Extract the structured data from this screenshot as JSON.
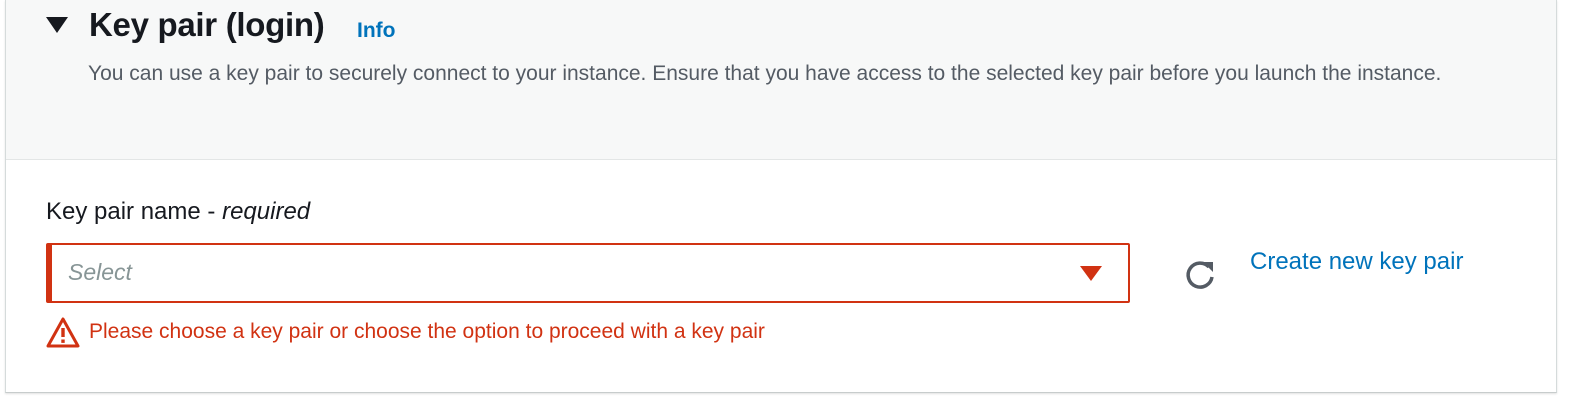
{
  "section": {
    "title": "Key pair (login)",
    "info_link": "Info",
    "description": "You can use a key pair to securely connect to your instance. Ensure that you have access to the selected key pair before you launch the instance."
  },
  "field": {
    "label": "Key pair name - ",
    "label_required": "required",
    "placeholder": "Select",
    "error": "Please choose a key pair or choose the option to proceed with a key pair"
  },
  "actions": {
    "refresh_icon": "refresh-icon",
    "create_link": "Create new key pair"
  },
  "colors": {
    "link": "#0073bb",
    "error": "#d13212",
    "text": "#16191f",
    "muted": "#545b64"
  }
}
